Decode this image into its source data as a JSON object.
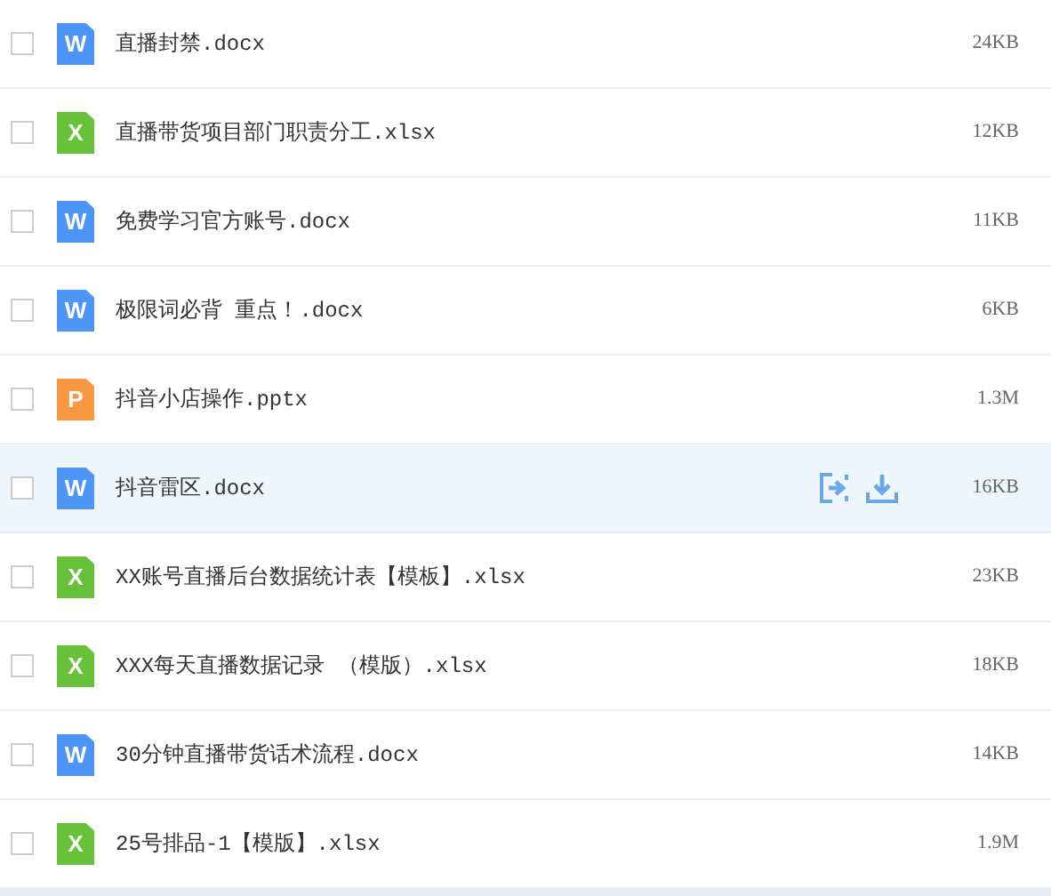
{
  "files": [
    {
      "name": "直播封禁.docx",
      "kind": "word",
      "badge": "W",
      "size": "24KB",
      "checked": false,
      "hovered": false
    },
    {
      "name": "直播带货项目部门职责分工.xlsx",
      "kind": "excel",
      "badge": "X",
      "size": "12KB",
      "checked": false,
      "hovered": false
    },
    {
      "name": "免费学习官方账号.docx",
      "kind": "word",
      "badge": "W",
      "size": "11KB",
      "checked": false,
      "hovered": false
    },
    {
      "name": "极限词必背 重点！.docx",
      "kind": "word",
      "badge": "W",
      "size": "6KB",
      "checked": false,
      "hovered": false
    },
    {
      "name": "抖音小店操作.pptx",
      "kind": "ppt",
      "badge": "P",
      "size": "1.3M",
      "checked": false,
      "hovered": false
    },
    {
      "name": "抖音雷区.docx",
      "kind": "word",
      "badge": "W",
      "size": "16KB",
      "checked": false,
      "hovered": true
    },
    {
      "name": "XX账号直播后台数据统计表【模板】.xlsx",
      "kind": "excel",
      "badge": "X",
      "size": "23KB",
      "checked": false,
      "hovered": false
    },
    {
      "name": "XXX每天直播数据记录 （模版）.xlsx",
      "kind": "excel",
      "badge": "X",
      "size": "18KB",
      "checked": false,
      "hovered": false
    },
    {
      "name": "30分钟直播带货话术流程.docx",
      "kind": "word",
      "badge": "W",
      "size": "14KB",
      "checked": false,
      "hovered": false
    },
    {
      "name": "25号排品-1【模版】.xlsx",
      "kind": "excel",
      "badge": "X",
      "size": "1.9M",
      "checked": false,
      "hovered": false
    }
  ]
}
